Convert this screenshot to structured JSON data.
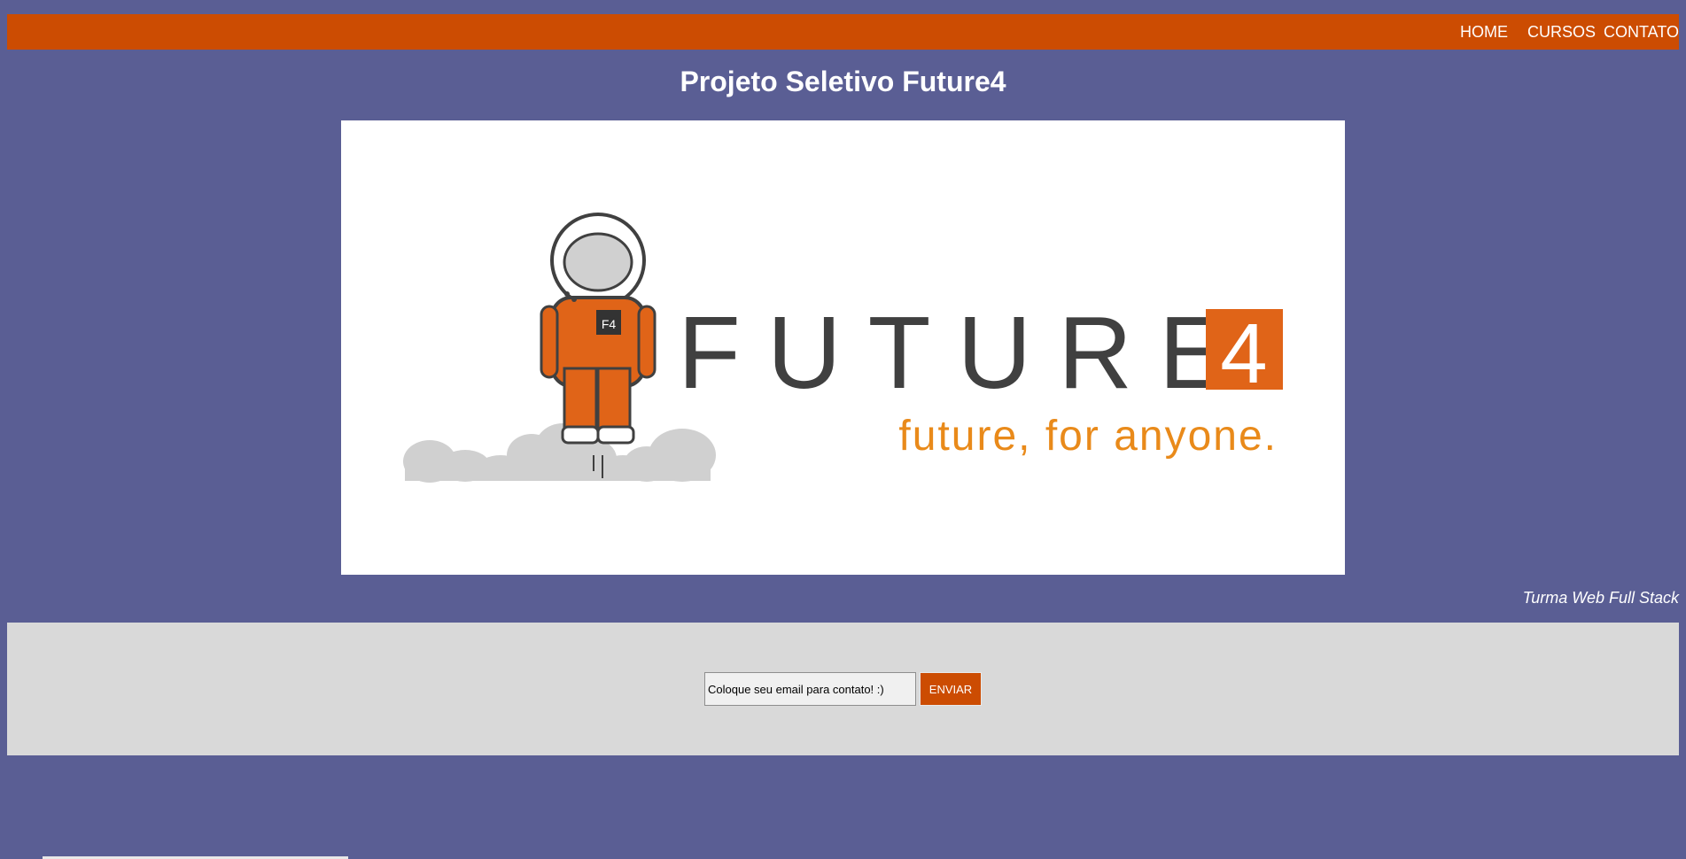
{
  "nav": {
    "items": [
      {
        "label": "HOME"
      },
      {
        "label": "CURSOS"
      },
      {
        "label": "CONTATO"
      }
    ]
  },
  "page": {
    "title": "Projeto Seletivo Future4",
    "caption": "Turma Web Full Stack"
  },
  "logo": {
    "wordmark": "FUTURE",
    "number": "4",
    "tagline": "future, for anyone.",
    "badge": "F4",
    "icon": "astronaut-icon"
  },
  "contact": {
    "email_placeholder": "Coloque seu email para contato! :)",
    "email_value": "",
    "send_label": "ENVIAR"
  },
  "colors": {
    "background": "#5a5e94",
    "accent": "#cc4c02",
    "panel": "#d9d9d9",
    "logo_orange": "#e06418",
    "logo_dark": "#404040",
    "cloud": "#d0d0d0"
  }
}
